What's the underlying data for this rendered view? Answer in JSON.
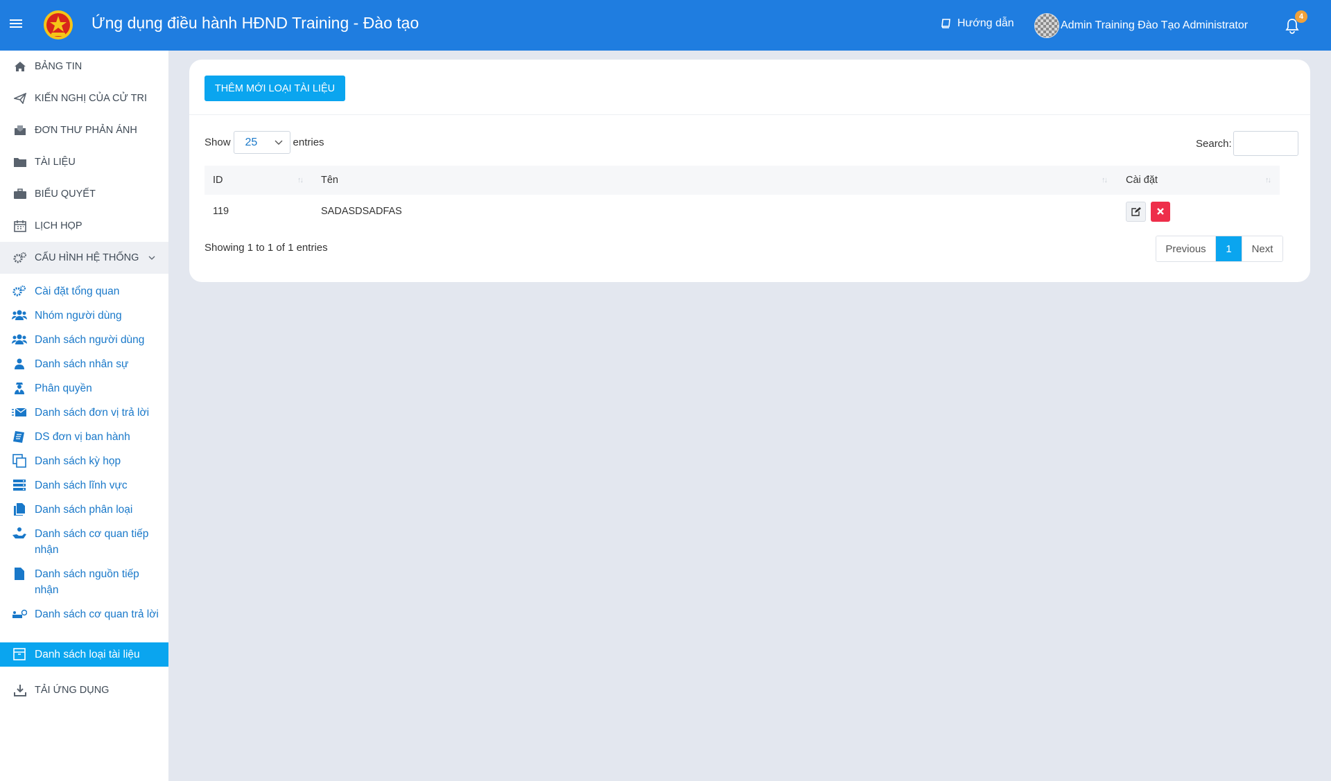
{
  "header": {
    "app_title": "Ứng dụng điều hành HĐND Training - Đào tạo",
    "guide_label": "Hướng dẫn",
    "user_name": "Admin Training Đào Tạo Administrator",
    "notification_count": "4",
    "brand_color": "#1f7de0"
  },
  "sidebar": {
    "items": [
      {
        "label": "BẢNG TIN",
        "icon": "home-icon"
      },
      {
        "label": "KIẾN NGHỊ CỦA CỬ TRI",
        "icon": "paper-plane-icon"
      },
      {
        "label": "ĐƠN THƯ PHẢN ÁNH",
        "icon": "inbox-icon"
      },
      {
        "label": "TÀI LIỆU",
        "icon": "folder-icon"
      },
      {
        "label": "BIỂU QUYẾT",
        "icon": "briefcase-icon"
      },
      {
        "label": "LỊCH HỌP",
        "icon": "calendar-icon"
      },
      {
        "label": "CẤU HÌNH HỆ THỐNG",
        "icon": "cogs-icon"
      }
    ],
    "sub_items": [
      {
        "label": "Cài đặt tổng quan",
        "icon": "cogs-icon"
      },
      {
        "label": "Nhóm người dùng",
        "icon": "users-icon"
      },
      {
        "label": "Danh sách người dùng",
        "icon": "users-icon"
      },
      {
        "label": "Danh sách nhân sự",
        "icon": "user-icon"
      },
      {
        "label": "Phân quyền",
        "icon": "user-secret-icon"
      },
      {
        "label": "Danh sách đơn vị trả lời",
        "icon": "envelope-icon"
      },
      {
        "label": "DS đơn vị ban hành",
        "icon": "file-text-icon"
      },
      {
        "label": "Danh sách kỳ họp",
        "icon": "clone-icon"
      },
      {
        "label": "Danh sách lĩnh vực",
        "icon": "server-icon"
      },
      {
        "label": "Danh sách phân loại",
        "icon": "files-icon"
      },
      {
        "label": "Danh sách cơ quan tiếp nhận",
        "icon": "hand-holding-icon"
      },
      {
        "label": "Danh sách nguồn tiếp nhận",
        "icon": "file-icon"
      },
      {
        "label": "Danh sách cơ quan trả lời",
        "icon": "people-carry-icon"
      },
      {
        "label": "Danh sách loại tài liệu",
        "icon": "archive-icon"
      }
    ],
    "download_label": "TẢI ỨNG DỤNG",
    "active_color": "#0aa5ef"
  },
  "main": {
    "add_button_label": "THÊM MỚI LOẠI TÀI LIỆU",
    "show_label": "Show",
    "entries_value": "25",
    "entries_label": "entries",
    "search_label": "Search:",
    "search_value": "",
    "columns": [
      "ID",
      "Tên",
      "Cài đặt"
    ],
    "rows": [
      {
        "id": "119",
        "name": "SADASDSADFAS"
      }
    ],
    "info_text": "Showing 1 to 1 of 1 entries",
    "pagination": {
      "previous": "Previous",
      "current": "1",
      "next": "Next"
    },
    "delete_color": "#ee2e4a"
  }
}
